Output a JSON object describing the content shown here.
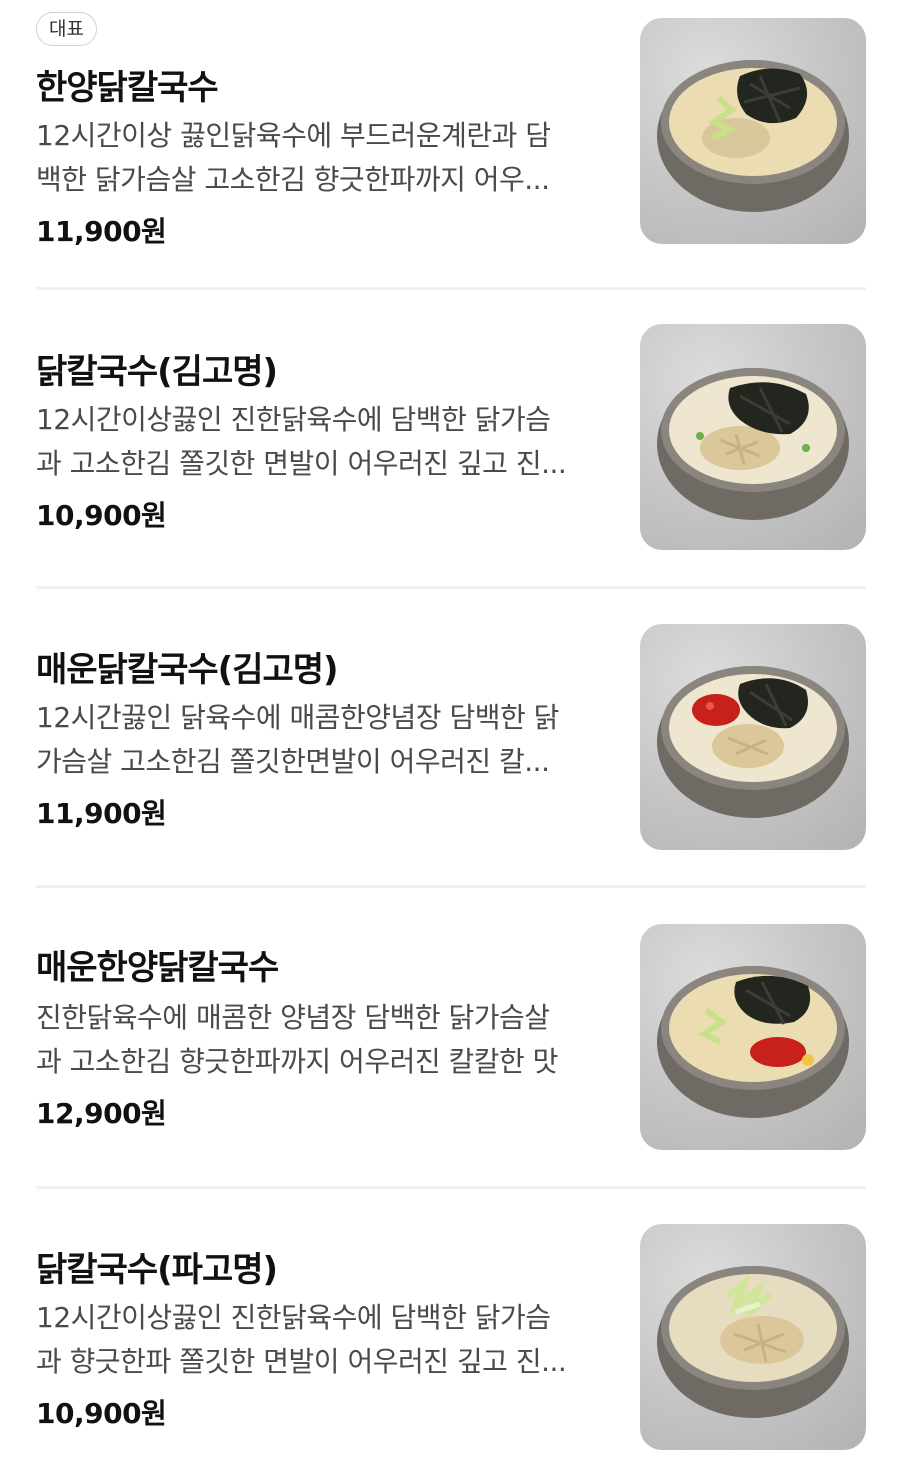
{
  "badge": "대표",
  "items": [
    {
      "title": "한양닭칼국수",
      "desc1": "12시간이상 끓인닭육수에 부드러운계란과 담",
      "desc2": "백한 닭가슴살 고소한김 향긋한파까지 어우...",
      "price": "11,900원",
      "image": "bowl-seaweed-greenonion-icon"
    },
    {
      "title": "닭칼국수(김고명)",
      "desc1": "12시간이상끓인 진한닭육수에 담백한 닭가슴",
      "desc2": "과 고소한김 쫄깃한 면발이 어우러진 깊고 진...",
      "price": "10,900원",
      "image": "bowl-seaweed-chicken-icon"
    },
    {
      "title": "매운닭칼국수(김고명)",
      "desc1": "12시간끓인 닭육수에 매콤한양념장 담백한 닭",
      "desc2": "가슴살 고소한김 쫄깃한면발이 어우러진 칼...",
      "price": "11,900원",
      "image": "bowl-seaweed-chili-icon"
    },
    {
      "title": "매운한양닭칼국수",
      "desc1": "진한닭육수에 매콤한 양념장 담백한 닭가슴살",
      "desc2": "과 고소한김 향긋한파까지 어우러진 칼칼한 맛",
      "price": "12,900원",
      "image": "bowl-seaweed-chili-greenonion-icon"
    },
    {
      "title": "닭칼국수(파고명)",
      "desc1": "12시간이상끓인 진한닭육수에 담백한 닭가슴",
      "desc2": "과 향긋한파 쫄깃한 면발이 어우러진 깊고 진...",
      "price": "10,900원",
      "image": "bowl-greenonion-chicken-icon"
    }
  ]
}
